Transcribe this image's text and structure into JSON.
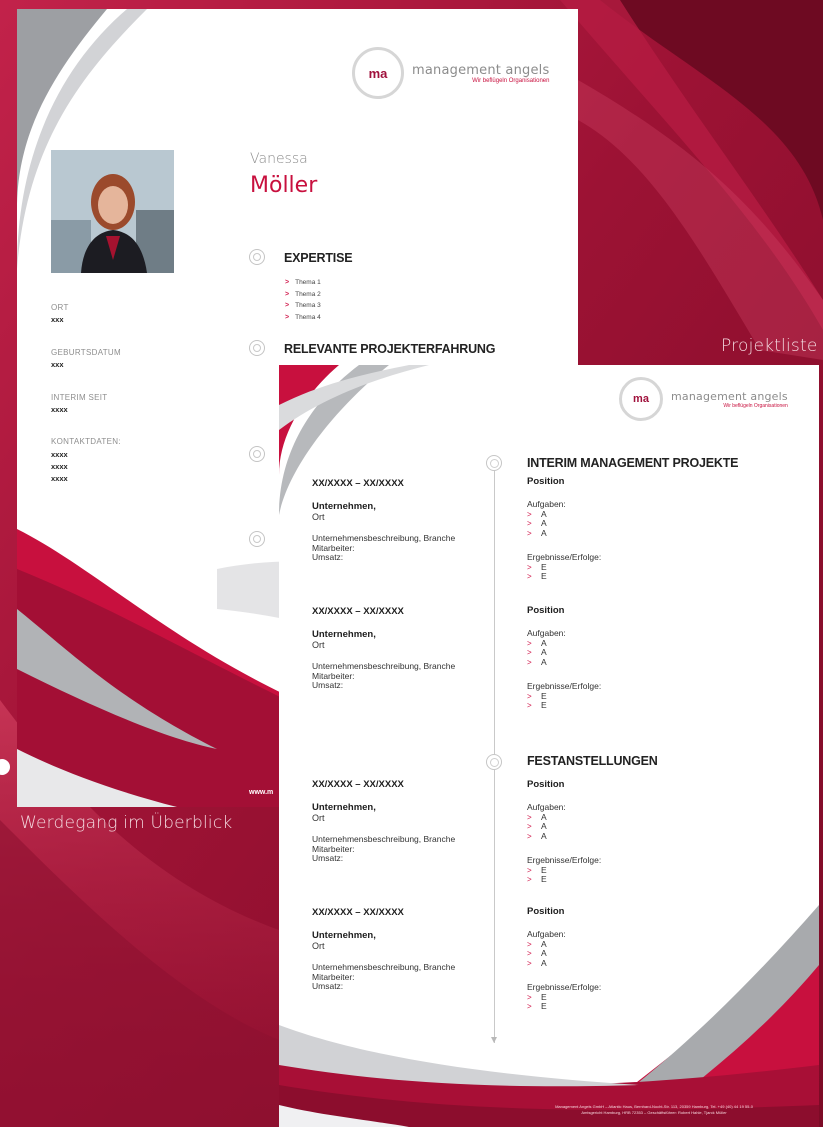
{
  "background": {
    "color_main": "#8a0f2c",
    "color_accent": "#c8103e",
    "color_light": "#d7385d"
  },
  "captions": {
    "projektliste": "Projektliste",
    "werdegang": "Werdegang im Überblick"
  },
  "logo": {
    "mark": "ma",
    "name": "management angels",
    "tagline": "Wir beflügeln Organisationen"
  },
  "profile": {
    "first_name": "Vanessa",
    "last_name": "Möller",
    "fields": [
      {
        "label": "ORT",
        "values": [
          "xxx"
        ]
      },
      {
        "label": "GEBURTSDATUM",
        "values": [
          "xxx"
        ]
      },
      {
        "label": "INTERIM SEIT",
        "values": [
          "xxxx"
        ]
      },
      {
        "label": "KONTAKTDATEN:",
        "values": [
          "xxxx",
          "xxxx",
          "xxxx"
        ]
      }
    ],
    "website": "www.m"
  },
  "sections": {
    "expertise": {
      "title": "EXPERTISE",
      "topics": [
        "Thema 1",
        "Thema 2",
        "Thema 3",
        "Thema 4"
      ]
    },
    "relevant": {
      "title": "RELEVANTE PROJEKTERFAHRUNG"
    }
  },
  "projektliste": {
    "interim_title": "INTERIM MANAGEMENT PROJEKTE",
    "festanstellungen_title": "FESTANSTELLUNGEN",
    "entries": [
      {
        "date": "XX/XXXX – XX/XXXX",
        "company": "Unternehmen,",
        "ort": "Ort",
        "desc": [
          "Unternehmensbeschreibung, Branche",
          "Mitarbeiter:",
          "Umsatz:"
        ],
        "position": "Position",
        "aufgaben_label": "Aufgaben:",
        "aufgaben": [
          "A",
          "A",
          "A"
        ],
        "ergebnisse_label": "Ergebnisse/Erfolge:",
        "ergebnisse": [
          "E",
          "E"
        ]
      },
      {
        "date": "XX/XXXX – XX/XXXX",
        "company": "Unternehmen,",
        "ort": "Ort",
        "desc": [
          "Unternehmensbeschreibung, Branche",
          "Mitarbeiter:",
          "Umsatz:"
        ],
        "position": "Position",
        "aufgaben_label": "Aufgaben:",
        "aufgaben": [
          "A",
          "A",
          "A"
        ],
        "ergebnisse_label": "Ergebnisse/Erfolge:",
        "ergebnisse": [
          "E",
          "E"
        ]
      },
      {
        "date": "XX/XXXX – XX/XXXX",
        "company": "Unternehmen,",
        "ort": "Ort",
        "desc": [
          "Unternehmensbeschreibung, Branche",
          "Mitarbeiter:",
          "Umsatz:"
        ],
        "position": "Position",
        "aufgaben_label": "Aufgaben:",
        "aufgaben": [
          "A",
          "A",
          "A"
        ],
        "ergebnisse_label": "Ergebnisse/Erfolge:",
        "ergebnisse": [
          "E",
          "E"
        ]
      },
      {
        "date": "XX/XXXX – XX/XXXX",
        "company": "Unternehmen,",
        "ort": "Ort",
        "desc": [
          "Unternehmensbeschreibung, Branche",
          "Mitarbeiter:",
          "Umsatz:"
        ],
        "position": "Position",
        "aufgaben_label": "Aufgaben:",
        "aufgaben": [
          "A",
          "A",
          "A"
        ],
        "ergebnisse_label": "Ergebnisse/Erfolge:",
        "ergebnisse": [
          "E",
          "E"
        ]
      }
    ],
    "footer": [
      "Management Angels GmbH – Atlantic Haus, Bernhard-Nocht-Str. 113, 20359 Hamburg, Tel. +49 (40) 44 19 55-0",
      "Amtsgericht Hamburg, HRB 72353 – Geschäftsführer: Robert Hahle, Tjarck Müller"
    ]
  }
}
